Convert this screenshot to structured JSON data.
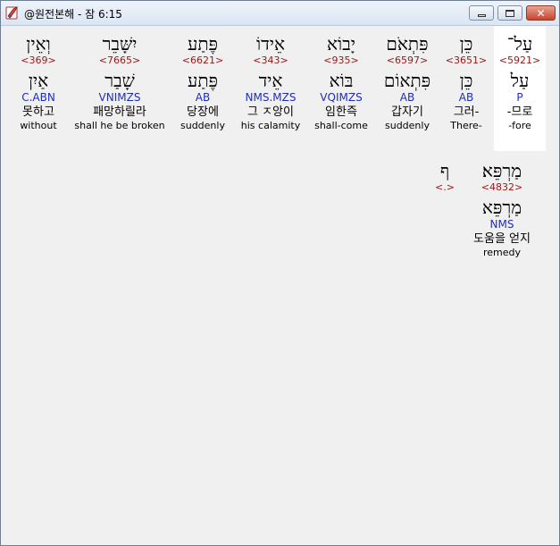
{
  "window": {
    "title": "@원전본해 - 잠 6:15",
    "buttons": {
      "minimize": "–",
      "maximize": "□",
      "close": "✕"
    }
  },
  "words": [
    {
      "hebrew": "עַל־",
      "strong": "<5921>",
      "lemma": "עַל",
      "grammar": "P",
      "korean": "-므로",
      "english": "-fore"
    },
    {
      "hebrew": "כֵּן",
      "strong": "<3651>",
      "lemma": "כֵּן",
      "grammar": "AB",
      "korean": "그러-",
      "english": "There-"
    },
    {
      "hebrew": "פִּתְאֹם",
      "strong": "<6597>",
      "lemma": "פִּתְאוֹם",
      "grammar": "AB",
      "korean": "갑자기",
      "english": "suddenly"
    },
    {
      "hebrew": "יָבוֹא",
      "strong": "<935>",
      "lemma": "בּוֹא",
      "grammar": "VQIMZS",
      "korean": "임한즉",
      "english": "shall-come"
    },
    {
      "hebrew": "אֵידוֹ",
      "strong": "<343>",
      "lemma": "אֵיד",
      "grammar": "NMS.MZS",
      "korean": "그 ㅈ앙이",
      "english": "his calamity"
    },
    {
      "hebrew": "פֶּתַע",
      "strong": "<6621>",
      "lemma": "פֶּתַע",
      "grammar": "AB",
      "korean": "당장에",
      "english": "suddenly"
    },
    {
      "hebrew": "יִשָּׁבֵר",
      "strong": "<7665>",
      "lemma": "שָׁבַר",
      "grammar": "VNIMZS",
      "korean": "패망하릴라",
      "english": "shall he be broken"
    },
    {
      "hebrew": "וְאֵין",
      "strong": "<369>",
      "lemma": "אַיִן",
      "grammar": "C.ABN",
      "korean": "못하고",
      "english": "without"
    },
    {
      "hebrew": "מַרְפֵּא׃",
      "strong": "<4832>",
      "lemma": "מַרְפֵּא",
      "grammar": "NMS",
      "korean": "도움을 얻지",
      "english": "remedy"
    },
    {
      "hebrew": "ף",
      "strong": "<.>"
    }
  ]
}
